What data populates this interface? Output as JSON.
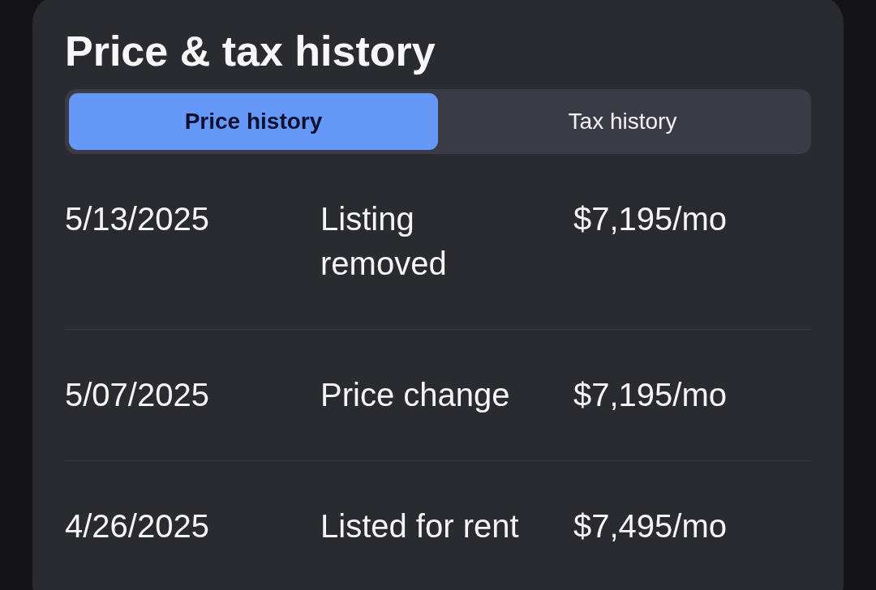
{
  "title": "Price & tax history",
  "tabs": [
    {
      "label": "Price history",
      "selected": true
    },
    {
      "label": "Tax history",
      "selected": false
    }
  ],
  "rows": [
    {
      "date": "5/13/2025",
      "event": "Listing removed",
      "price": "$7,195/mo"
    },
    {
      "date": "5/07/2025",
      "event": "Price change",
      "price": "$7,195/mo"
    },
    {
      "date": "4/26/2025",
      "event": "Listed for rent",
      "price": "$7,495/mo"
    }
  ]
}
